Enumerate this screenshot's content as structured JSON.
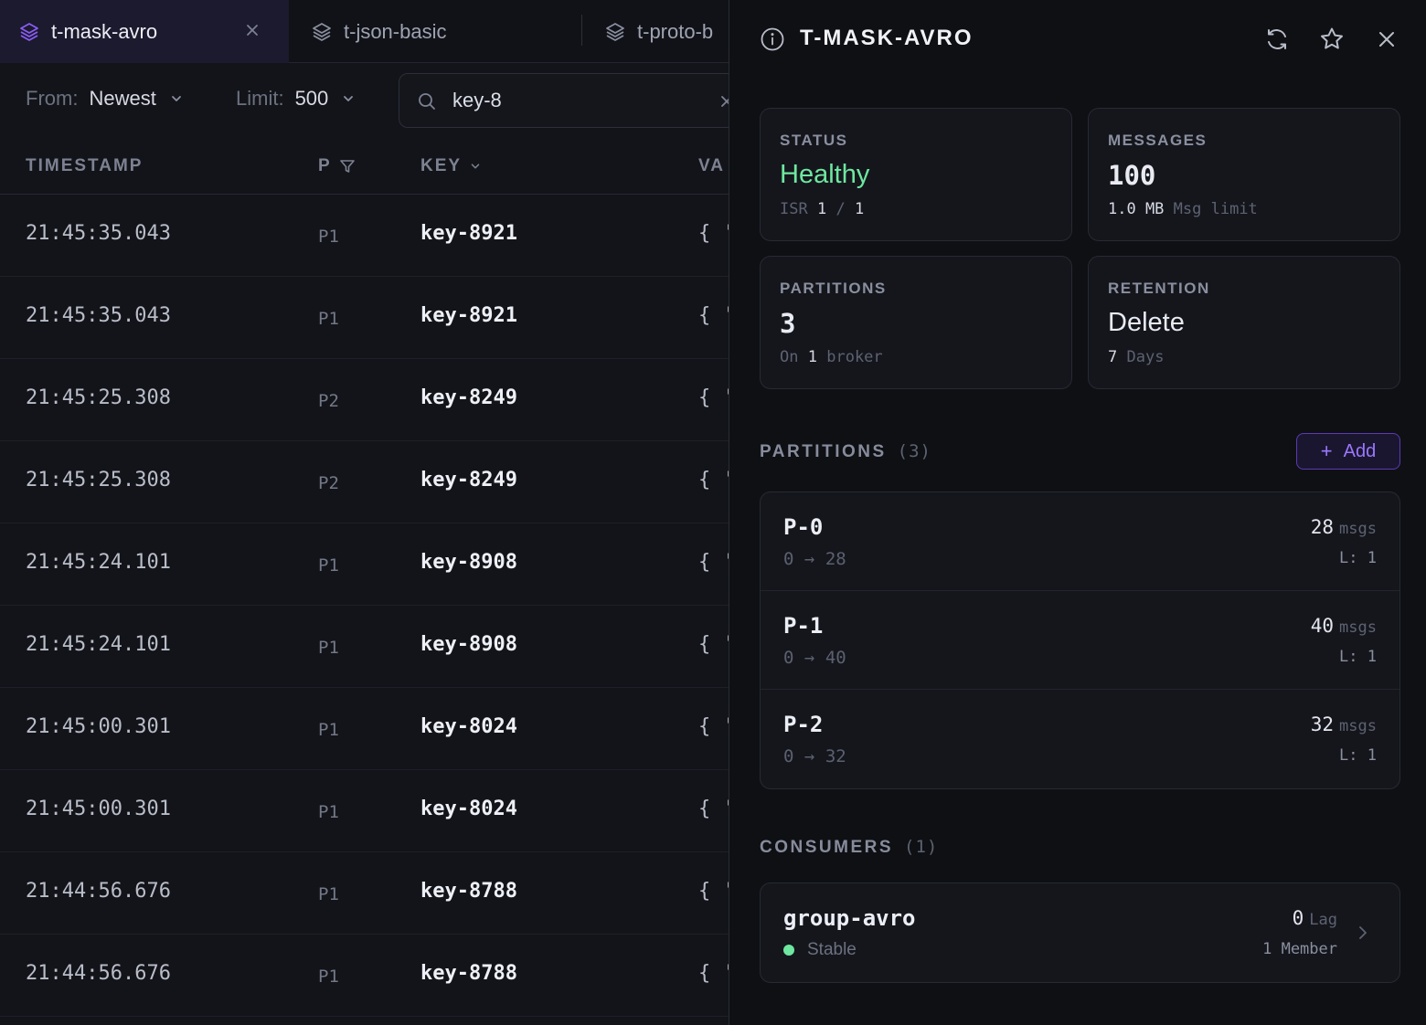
{
  "tabs": [
    {
      "label": "t-mask-avro",
      "active": true
    },
    {
      "label": "t-json-basic",
      "active": false
    },
    {
      "label": "t-proto-b",
      "active": false
    }
  ],
  "filters": {
    "from_label": "From:",
    "from_value": "Newest",
    "limit_label": "Limit:",
    "limit_value": "500",
    "search_value": "key-8"
  },
  "table": {
    "columns": {
      "timestamp": "TIMESTAMP",
      "partition": "P",
      "key": "KEY",
      "value": "VA"
    },
    "rows": [
      {
        "timestamp": "21:45:35.043",
        "partition": "P1",
        "key": "key-8921",
        "value": "{ '"
      },
      {
        "timestamp": "21:45:35.043",
        "partition": "P1",
        "key": "key-8921",
        "value": "{ '"
      },
      {
        "timestamp": "21:45:25.308",
        "partition": "P2",
        "key": "key-8249",
        "value": "{ '"
      },
      {
        "timestamp": "21:45:25.308",
        "partition": "P2",
        "key": "key-8249",
        "value": "{ '"
      },
      {
        "timestamp": "21:45:24.101",
        "partition": "P1",
        "key": "key-8908",
        "value": "{ '"
      },
      {
        "timestamp": "21:45:24.101",
        "partition": "P1",
        "key": "key-8908",
        "value": "{ '"
      },
      {
        "timestamp": "21:45:00.301",
        "partition": "P1",
        "key": "key-8024",
        "value": "{ '"
      },
      {
        "timestamp": "21:45:00.301",
        "partition": "P1",
        "key": "key-8024",
        "value": "{ '"
      },
      {
        "timestamp": "21:44:56.676",
        "partition": "P1",
        "key": "key-8788",
        "value": "{ '"
      },
      {
        "timestamp": "21:44:56.676",
        "partition": "P1",
        "key": "key-8788",
        "value": "{ '"
      }
    ]
  },
  "panel": {
    "title": "T-MASK-AVRO",
    "status": {
      "label": "STATUS",
      "value": "Healthy",
      "isr_label": "ISR",
      "isr_in": "1",
      "isr_sep": "/",
      "isr_total": "1"
    },
    "messages": {
      "label": "MESSAGES",
      "value": "100",
      "size": "1.0 MB",
      "size_suffix": "Msg limit"
    },
    "partitions_card": {
      "label": "PARTITIONS",
      "value": "3",
      "prefix": "On",
      "brokers": "1",
      "suffix": "broker"
    },
    "retention": {
      "label": "RETENTION",
      "value": "Delete",
      "days": "7",
      "days_suffix": "Days"
    },
    "partitions_section": {
      "label": "PARTITIONS",
      "count": "(3)",
      "add_label": "Add"
    },
    "partitions": [
      {
        "name": "P-0",
        "start": "0",
        "arrow": "→",
        "end": "28",
        "msgs": "28",
        "msgs_unit": "msgs",
        "leader": "L: 1"
      },
      {
        "name": "P-1",
        "start": "0",
        "arrow": "→",
        "end": "40",
        "msgs": "40",
        "msgs_unit": "msgs",
        "leader": "L: 1"
      },
      {
        "name": "P-2",
        "start": "0",
        "arrow": "→",
        "end": "32",
        "msgs": "32",
        "msgs_unit": "msgs",
        "leader": "L: 1"
      }
    ],
    "consumers_section": {
      "label": "CONSUMERS",
      "count": "(1)"
    },
    "consumers": [
      {
        "name": "group-avro",
        "state": "Stable",
        "lag": "0",
        "lag_unit": "Lag",
        "members": "1 Member"
      }
    ]
  },
  "colors": {
    "accent": "#8b5cf6",
    "healthy": "#6ee7a0",
    "background": "#131419",
    "panel_background": "#0f1014"
  },
  "icons": {
    "tab": "layers-icon",
    "search": "search-icon",
    "info": "info-icon",
    "refresh": "refresh-icon",
    "favorite": "star-icon",
    "close": "close-icon",
    "filter": "filter-icon",
    "sort": "chevron-down-icon",
    "consumer": "chevron-right-icon"
  }
}
